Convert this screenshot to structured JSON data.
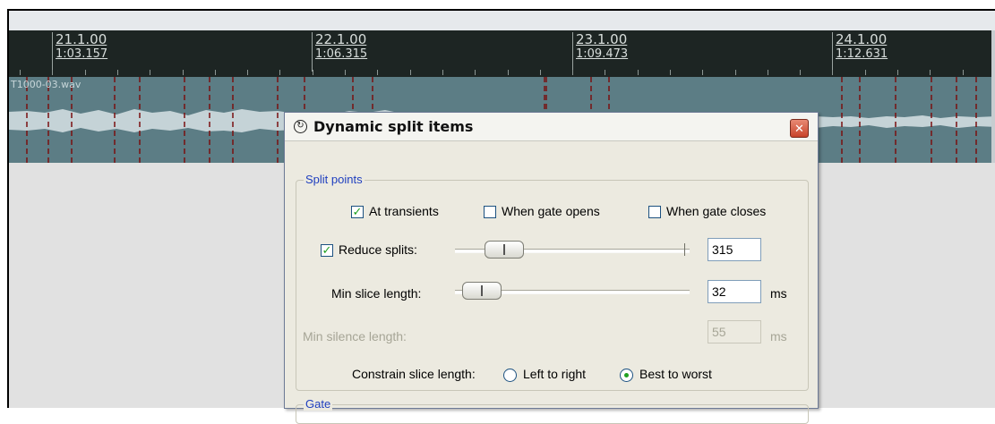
{
  "timeline": {
    "markers": [
      {
        "bar": "21.1.00",
        "time": "1:03.157"
      },
      {
        "bar": "22.1.00",
        "time": "1:06.315"
      },
      {
        "bar": "23.1.00",
        "time": "1:09.473"
      },
      {
        "bar": "24.1.00",
        "time": "1:12.631"
      }
    ]
  },
  "track": {
    "item_name": "T1000-03.wav"
  },
  "dialog": {
    "icon": "reaper-logo-icon",
    "title": "Dynamic split items",
    "close_symbol": "✕",
    "split_points": {
      "group_label": "Split points",
      "at_transients": {
        "label": "At transients",
        "checked": true
      },
      "when_gate_opens": {
        "label": "When gate opens",
        "checked": false
      },
      "when_gate_closes": {
        "label": "When gate closes",
        "checked": false
      },
      "reduce_splits": {
        "label": "Reduce splits:",
        "checked": true,
        "value": "315",
        "slider_fraction": 0.17
      },
      "min_slice_length": {
        "label": "Min slice length:",
        "value": "32",
        "unit": "ms",
        "slider_fraction": 0.06
      },
      "min_silence_length": {
        "label": "Min silence length:",
        "value": "55",
        "unit": "ms",
        "enabled": false
      },
      "constrain": {
        "label": "Constrain slice length:",
        "options": [
          {
            "label": "Left to right",
            "selected": false
          },
          {
            "label": "Best to worst",
            "selected": true
          }
        ]
      }
    },
    "gate": {
      "group_label": "Gate"
    }
  }
}
